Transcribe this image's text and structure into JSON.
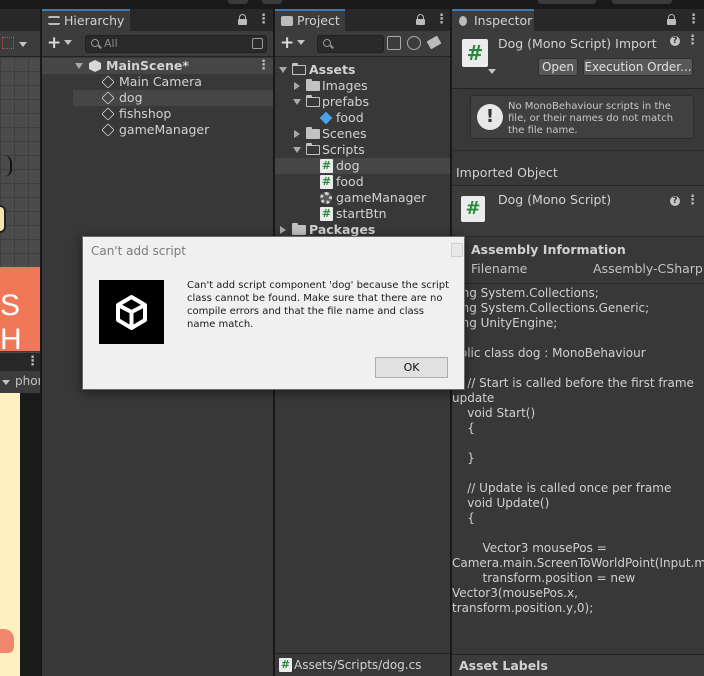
{
  "hierarchy": {
    "tab_title": "Hierarchy",
    "search_placeholder": "All",
    "items": [
      {
        "label": "MainScene*"
      },
      {
        "label": "Main Camera"
      },
      {
        "label": "dog"
      },
      {
        "label": "fishshop"
      },
      {
        "label": "gameManager"
      }
    ]
  },
  "project": {
    "tab_title": "Project",
    "tree": [
      {
        "label": "Assets"
      },
      {
        "label": "Images"
      },
      {
        "label": "prefabs"
      },
      {
        "label": "food"
      },
      {
        "label": "Scenes"
      },
      {
        "label": "Scripts"
      },
      {
        "label": "dog"
      },
      {
        "label": "food"
      },
      {
        "label": "gameManager"
      },
      {
        "label": "startBtn"
      },
      {
        "label": "Packages"
      }
    ],
    "status_path": "Assets/Scripts/dog.cs"
  },
  "inspector": {
    "tab_title": "Inspector",
    "header_title": "Dog (Mono Script) Import",
    "open_label": "Open",
    "exec_order_label": "Execution Order...",
    "help_text": "No MonoBehaviour scripts in the file, or their names do not match the file name.",
    "imported_object_label": "Imported Object",
    "component_title": "Dog (Mono Script)",
    "assembly_header": "Assembly Information",
    "filename_label": "Filename",
    "filename_value": "Assembly-CSharp",
    "code": "sing System.Collections;\nsing System.Collections.Generic;\nsing UnityEngine;\n\nublic class dog : MonoBehaviour\n\n    // Start is called before the first frame update\n    void Start()\n    {\n\n    }\n\n    // Update is called once per frame\n    void Update()\n    {\n\n        Vector3 mousePos = Camera.main.ScreenToWorldPoint(Input.mousePosition);\n        transform.position = new Vector3(mousePos.x, transform.position.y,0);",
    "asset_labels": "Asset Labels"
  },
  "scene": {
    "shop_text": "S H",
    "game_dropdown": "phon"
  },
  "dialog": {
    "title": "Can't add script",
    "message": "Can't add script component 'dog' because the script class cannot be found. Make sure that there are no compile errors and that the file name and class name match.",
    "ok_label": "OK"
  },
  "colors": {
    "accent": "#3a79bb",
    "panel_bg": "#383838",
    "selection": "#464646"
  }
}
